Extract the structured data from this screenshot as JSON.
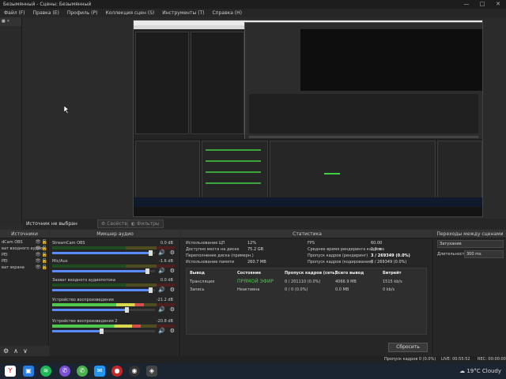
{
  "window": {
    "title": "Безымянный - Сцены: Безымянный",
    "controls": [
      "—",
      "□",
      "✕"
    ]
  },
  "menu": [
    "Файл (F)",
    "Правка (E)",
    "Профиль (P)",
    "Коллекция сцен (S)",
    "Инструменты (T)",
    "Справка (H)"
  ],
  "status_strip": {
    "no_source": "Источник не выбран",
    "properties": "Свойства",
    "filters": "Фильтры"
  },
  "panels": {
    "sources": "Источники",
    "mixer": "Микшер аудио",
    "stats": "Статистика",
    "transitions": "Переходы между сценами"
  },
  "sources": [
    {
      "label": "dCam OBS"
    },
    {
      "label": "ват входного аудио"
    },
    {
      "label": "PEI"
    },
    {
      "label": "PEI"
    },
    {
      "label": "ват экрана"
    }
  ],
  "mixer": [
    {
      "name": "StreamCam OBS",
      "db": "0.0 dB",
      "level": 0.0,
      "volume": 0.95
    },
    {
      "name": "Mic/Aux",
      "db": "-1.6 dB",
      "level": 0.0,
      "volume": 0.92
    },
    {
      "name": "Захват входного аудиопотока",
      "db": "0.0 dB",
      "level": 0.0,
      "volume": 0.95
    },
    {
      "name": "Устройство воспроизведения",
      "db": "-21.2 dB",
      "level": 0.75,
      "volume": 0.72
    },
    {
      "name": "Устройство воспроизведения 2",
      "db": "-20.8 dB",
      "level": 0.72,
      "volume": 0.48
    }
  ],
  "stats": {
    "cpu_label": "Использование ЦП",
    "cpu_value": "12%",
    "disk_label": "Доступно места на диске",
    "disk_value": "75.2 GB",
    "overflow_label": "Переполнение диска (примерн.)",
    "overflow_value": "",
    "mem_label": "Использование памяти",
    "mem_value": "260.7 MB",
    "fps_label": "FPS",
    "fps_value": "60.00",
    "render_time_label": "Среднее время рендеринга кадров",
    "render_time_value": "1.9 ms",
    "missed_render_label": "Пропуск кадров (рендеринг)",
    "missed_render_value": "3 / 269349 (0.0%)",
    "missed_encode_label": "Пропуск кадров (кодирование)",
    "missed_encode_value": "0 / 269349 (0.0%)",
    "table_headers": [
      "Вывод",
      "Состояние",
      "Пропуск кадров (сеть)",
      "Всего вывод",
      "Битрейт"
    ],
    "rows": [
      {
        "output": "Трансляция",
        "state": "ПРЯМОЙ ЭФИР",
        "dropped": "0 / 201110 (0.0%)",
        "total": "4066.9 MB",
        "bitrate": "1515 kb/s"
      },
      {
        "output": "Запись",
        "state": "Неактивна",
        "dropped": "0 / 0 (0.0%)",
        "total": "0.0 MB",
        "bitrate": "0 kb/s"
      }
    ],
    "reset_label": "Сбросить"
  },
  "transitions": {
    "selected": "Затухание",
    "duration_label": "Длительность",
    "duration_value": "300 ms"
  },
  "statusbar": {
    "dropped": "Пропуск кадров 0 (0.0%)",
    "live": "LIVE: 00:55:52",
    "rec": "REC: 00:00:00"
  },
  "taskbar": {
    "temp": "19°C",
    "weather": "Cloudy"
  }
}
